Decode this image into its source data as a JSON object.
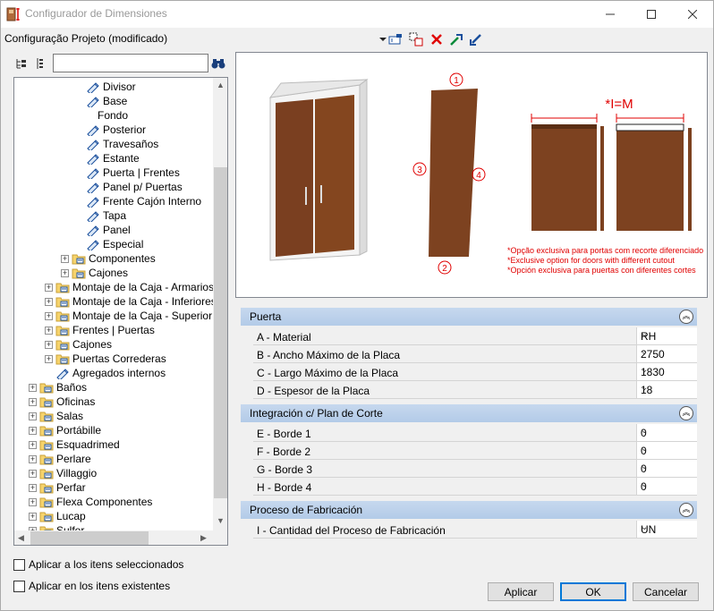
{
  "window": {
    "title": "Configurador de Dimensiones"
  },
  "menubar": {
    "project": "Configuração Projeto (modificado)"
  },
  "tree": {
    "rows": [
      {
        "label": "Divisor",
        "level": 3,
        "icon": "pencil-icon"
      },
      {
        "label": "Base",
        "level": 3,
        "icon": "pencil-icon"
      },
      {
        "label": "Fondo",
        "level": 3,
        "icon": "none"
      },
      {
        "label": "Posterior",
        "level": 3,
        "icon": "pencil-icon"
      },
      {
        "label": "Travesaños",
        "level": 3,
        "icon": "pencil-icon"
      },
      {
        "label": "Estante",
        "level": 3,
        "icon": "pencil-icon"
      },
      {
        "label": "Puerta | Frentes",
        "level": 3,
        "icon": "pencil-icon"
      },
      {
        "label": "Panel p/ Puertas",
        "level": 3,
        "icon": "pencil-icon"
      },
      {
        "label": "Frente Cajón Interno",
        "level": 3,
        "icon": "pencil-icon"
      },
      {
        "label": "Tapa",
        "level": 3,
        "icon": "pencil-icon"
      },
      {
        "label": "Panel",
        "level": 3,
        "icon": "pencil-icon"
      },
      {
        "label": "Especial",
        "level": 3,
        "icon": "pencil-icon"
      },
      {
        "label": "Componentes",
        "level": 2,
        "icon": "folder-icon"
      },
      {
        "label": "Cajones",
        "level": 2,
        "icon": "folder-icon"
      },
      {
        "label": "Montaje de la Caja - Armarios",
        "level": 1,
        "icon": "folder-icon"
      },
      {
        "label": "Montaje de la Caja - Inferiores",
        "level": 1,
        "icon": "folder-icon"
      },
      {
        "label": "Montaje de la Caja - Superior",
        "level": 1,
        "icon": "folder-icon"
      },
      {
        "label": "Frentes | Puertas",
        "level": 1,
        "icon": "folder-icon"
      },
      {
        "label": "Cajones",
        "level": 1,
        "icon": "folder-icon"
      },
      {
        "label": "Puertas Correderas",
        "level": 1,
        "icon": "folder-icon"
      },
      {
        "label": "Agregados internos",
        "level": 1,
        "icon": "pencil-icon"
      },
      {
        "label": "Baños",
        "level": 0,
        "icon": "folder-icon"
      },
      {
        "label": "Oficinas",
        "level": 0,
        "icon": "folder-icon"
      },
      {
        "label": "Salas",
        "level": 0,
        "icon": "folder-icon"
      },
      {
        "label": "Portábille",
        "level": 0,
        "icon": "folder-icon"
      },
      {
        "label": "Esquadrimed",
        "level": 0,
        "icon": "folder-icon"
      },
      {
        "label": "Perlare",
        "level": 0,
        "icon": "folder-icon"
      },
      {
        "label": "Villaggio",
        "level": 0,
        "icon": "folder-icon"
      },
      {
        "label": "Perfar",
        "level": 0,
        "icon": "folder-icon"
      },
      {
        "label": "Flexa Componentes",
        "level": 0,
        "icon": "folder-icon"
      },
      {
        "label": "Lucap",
        "level": 0,
        "icon": "folder-icon"
      },
      {
        "label": "Sulfer",
        "level": 0,
        "icon": "folder-icon"
      }
    ]
  },
  "preview": {
    "formula": "*I=M",
    "callouts": [
      "1",
      "2",
      "3",
      "4"
    ],
    "notes": [
      "*Opção exclusiva para portas com recorte diferenciado",
      "*Exclusive option for doors with different cutout",
      "*Opción exclusiva para puertas con diferentes cortes"
    ]
  },
  "sections": [
    {
      "title": "Puerta",
      "rows": [
        {
          "label": "A - Material",
          "value": "RH"
        },
        {
          "label": "B -  Ancho Máximo de la Placa",
          "value": "2750"
        },
        {
          "label": "C - Largo Máximo de la Placa",
          "value": "1830"
        },
        {
          "label": "D - Espesor de la Placa",
          "value": "18"
        }
      ]
    },
    {
      "title": "Integración c/ Plan de Corte",
      "rows": [
        {
          "label": "E - Borde 1",
          "value": "0"
        },
        {
          "label": "F - Borde 2",
          "value": "0"
        },
        {
          "label": "G - Borde 3",
          "value": "0"
        },
        {
          "label": "H - Borde 4",
          "value": "0"
        }
      ]
    },
    {
      "title": "Proceso de Fabricación",
      "rows": [
        {
          "label": "I - Cantidad del Proceso de Fabricación",
          "value": "UN"
        }
      ]
    }
  ],
  "options": {
    "apply_selected": "Aplicar a los itens seleccionados",
    "apply_existing": "Aplicar en los itens existentes"
  },
  "buttons": {
    "apply": "Aplicar",
    "ok": "OK",
    "cancel": "Cancelar"
  },
  "colors": {
    "wood": "#7a3f20",
    "accent_red": "#e00000",
    "section_bg": "#c1d5ed"
  }
}
